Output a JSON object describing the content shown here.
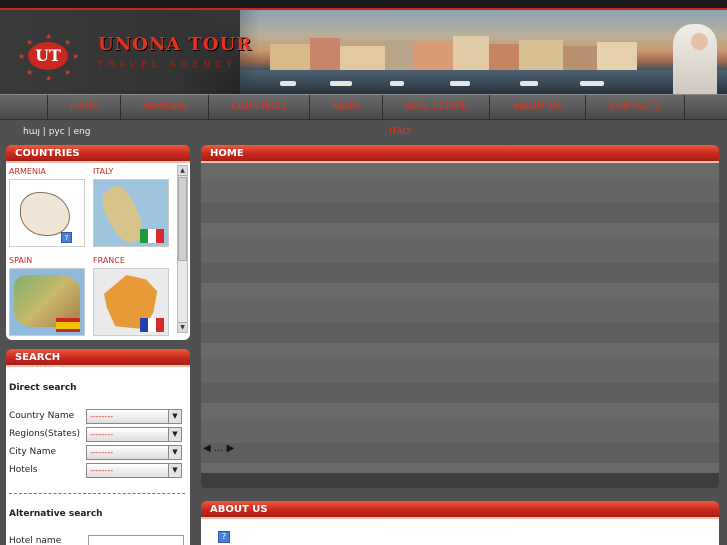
{
  "brand": {
    "name": "UNONA TOUR",
    "tagline": "TRAVEL AGENCY",
    "logo_text": "UT"
  },
  "nav": {
    "items": [
      {
        "label": "HOME"
      },
      {
        "label": "ARMENIA"
      },
      {
        "label": "COUNTRIES"
      },
      {
        "label": "NEWS"
      },
      {
        "label": "REAL ESTATE"
      },
      {
        "label": "ABOUT US"
      },
      {
        "label": "CONTACTS"
      }
    ]
  },
  "languages": {
    "hy": "հայ",
    "ru": "рус",
    "en": "eng",
    "separator": "|"
  },
  "breadcrumb": "ITALY",
  "countries_panel": {
    "title": "COUNTRIES",
    "items": [
      {
        "name": "ARMENIA",
        "icon": "broken-image-icon"
      },
      {
        "name": "ITALY",
        "flag": [
          "#1d9a3c",
          "#ffffff",
          "#d62a2a"
        ]
      },
      {
        "name": "SPAIN",
        "flag": [
          "#c8281e",
          "#f5c400",
          "#c8281e"
        ]
      },
      {
        "name": "FRANCE",
        "flag": [
          "#2341a8",
          "#ffffff",
          "#d62a2a"
        ]
      }
    ]
  },
  "search_panel": {
    "title": "SEARCH",
    "direct_search": "Direct search",
    "fields": [
      {
        "label": "Country Name",
        "value": "--------"
      },
      {
        "label": "Regions(States)",
        "value": "--------"
      },
      {
        "label": "City Name",
        "value": "--------"
      },
      {
        "label": "Hotels",
        "value": "--------"
      }
    ],
    "alternative_search": "Alternative search",
    "hotel_name_label": "Hotel name"
  },
  "home_panel": {
    "title": "HOME",
    "pager": "◀ ... ▶"
  },
  "about_panel": {
    "title": "ABOUT US"
  },
  "colors": {
    "accent": "#c8281e",
    "background": "#505050",
    "header": "#2a2a2a"
  }
}
